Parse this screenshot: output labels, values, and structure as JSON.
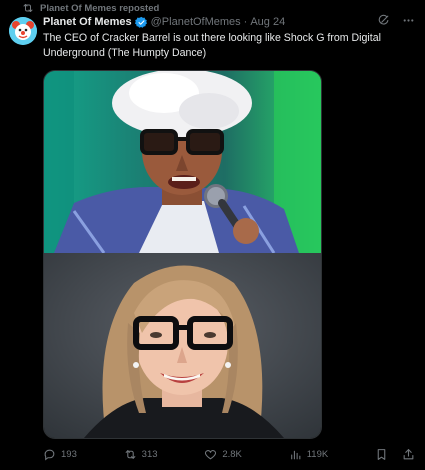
{
  "repost": {
    "text": "Planet Of Memes reposted",
    "icon": "repost-icon"
  },
  "author": {
    "display_name": "Planet Of Memes",
    "handle": "@PlanetOfMemes",
    "separator": "·",
    "date": "Aug 24",
    "verified": true
  },
  "tweet": {
    "text": "The CEO of Cracker Barrel is out there looking like Shock G from Digital Underground (The Humpty Dance)"
  },
  "actions": {
    "replies": "193",
    "reposts": "313",
    "likes": "2.8K",
    "views": "119K"
  },
  "colors": {
    "background": "#000000",
    "text": "#e7e9ea",
    "muted": "#71767b",
    "verified": "#1d9bf0"
  }
}
